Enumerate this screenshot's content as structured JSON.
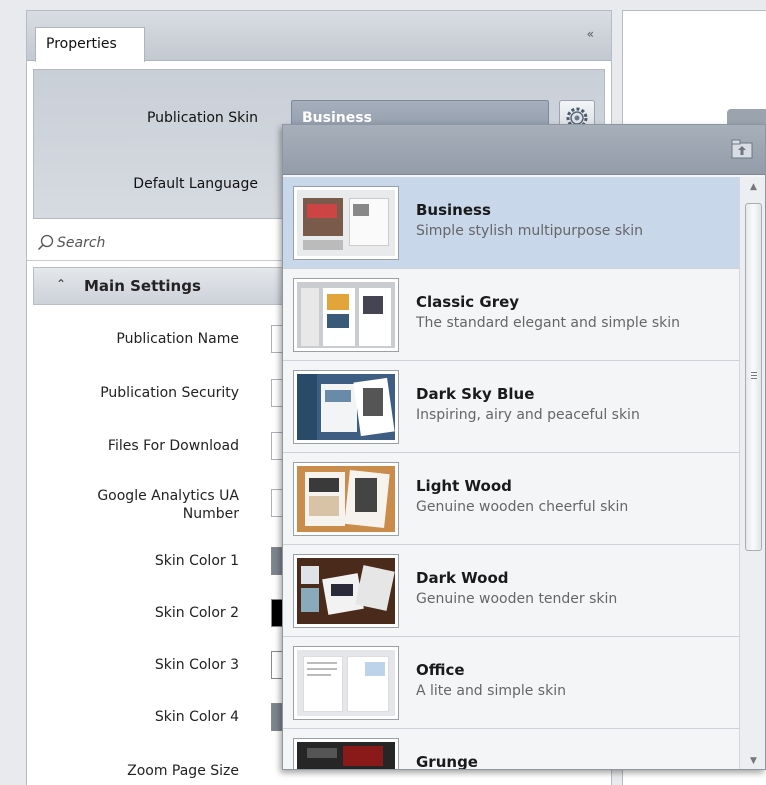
{
  "panel": {
    "tab_label": "Properties",
    "collapse_glyph": "«"
  },
  "top": {
    "skin_label": "Publication Skin",
    "skin_value": "Business",
    "language_label": "Default Language"
  },
  "search": {
    "placeholder": "Search"
  },
  "main_settings": {
    "title": "Main Settings",
    "rows": [
      {
        "label": "Publication Name"
      },
      {
        "label": "Publication Security"
      },
      {
        "label": "Files For Download"
      },
      {
        "label": "Google Analytics UA Number"
      },
      {
        "label": "Skin Color 1"
      },
      {
        "label": "Skin Color 2"
      },
      {
        "label": "Skin Color 3"
      },
      {
        "label": "Skin Color 4"
      },
      {
        "label": "Zoom Page Size"
      }
    ],
    "swatch_colors": {
      "skin_color_1": "#7d8591",
      "skin_color_2": "#000000",
      "skin_color_3": "#ffffff",
      "skin_color_4": "#7d8591"
    }
  },
  "skin_list": {
    "items": [
      {
        "name": "Business",
        "description": "Simple stylish multipurpose skin",
        "selected": true
      },
      {
        "name": "Classic Grey",
        "description": "The standard elegant and simple skin",
        "selected": false
      },
      {
        "name": "Dark Sky Blue",
        "description": "Inspiring, airy and peaceful skin",
        "selected": false
      },
      {
        "name": "Light Wood",
        "description": "Genuine wooden cheerful skin",
        "selected": false
      },
      {
        "name": "Dark Wood",
        "description": "Genuine wooden tender skin",
        "selected": false
      },
      {
        "name": "Office",
        "description": "A lite and simple skin",
        "selected": false
      },
      {
        "name": "Grunge",
        "description": "",
        "selected": false
      }
    ]
  },
  "colors": {
    "selected_row": "#c8d7ea",
    "header": "#9ba4b0"
  }
}
